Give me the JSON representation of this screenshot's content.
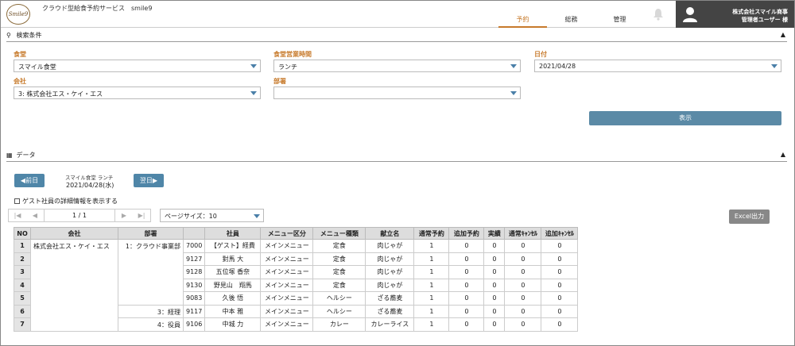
{
  "header": {
    "logo_text": "Smile9",
    "app_title": "クラウド型給食予約サービス　smile9",
    "tabs": [
      {
        "label": "予約",
        "active": true
      },
      {
        "label": "総務",
        "active": false
      },
      {
        "label": "管理",
        "active": false
      }
    ],
    "user_company": "株式会社スマイル商事",
    "user_name": "管理者ユーザー 様"
  },
  "search": {
    "section_title": "検索条件",
    "cafeteria_label": "食堂",
    "cafeteria_value": "スマイル食堂",
    "hours_label": "食堂営業時間",
    "hours_value": "ランチ",
    "date_label": "日付",
    "date_value": "2021/04/28",
    "company_label": "会社",
    "company_value": "3: 株式会社エス・ケイ・エス",
    "dept_label": "部署",
    "dept_value": "",
    "show_button": "表示"
  },
  "data_section": {
    "section_title": "データ",
    "prev_button": "◀前日",
    "next_button": "翌日▶",
    "caf_info": "スマイル食堂 ランチ",
    "caf_date": "2021/04/28(水)",
    "guest_checkbox_label": "ゲスト社員の詳細情報を表示する",
    "pager_info": "1 / 1",
    "page_size": "ページサイズ：10",
    "excel_button": "Excel出力"
  },
  "table": {
    "headers": [
      "NO",
      "会社",
      "部署",
      "社員",
      "",
      "メニュー区分",
      "メニュー種類",
      "献立名",
      "通常予約",
      "追加予約",
      "実績",
      "通常ｷｬﾝｾﾙ",
      "追加ｷｬﾝｾﾙ"
    ],
    "company": "株式会社エス・ケイ・エス",
    "depts": [
      "1：クラウド事業部",
      "3：経理",
      "4：役員"
    ],
    "rows": [
      {
        "no": "1",
        "emp_id": "7000",
        "emp_name": "【ゲスト】経費",
        "menu_cat": "メインメニュー",
        "menu_type": "定食",
        "dish": "肉じゃが",
        "normal": "1",
        "add": "0",
        "actual": "0",
        "ncancel": "0",
        "acancel": "0"
      },
      {
        "no": "2",
        "emp_id": "9127",
        "emp_name": "對馬 大",
        "menu_cat": "メインメニュー",
        "menu_type": "定食",
        "dish": "肉じゃが",
        "normal": "1",
        "add": "0",
        "actual": "0",
        "ncancel": "0",
        "acancel": "0"
      },
      {
        "no": "3",
        "emp_id": "9128",
        "emp_name": "五位塚 香奈",
        "menu_cat": "メインメニュー",
        "menu_type": "定食",
        "dish": "肉じゃが",
        "normal": "1",
        "add": "0",
        "actual": "0",
        "ncancel": "0",
        "acancel": "0"
      },
      {
        "no": "4",
        "emp_id": "9130",
        "emp_name": "野見山　翔馬",
        "menu_cat": "メインメニュー",
        "menu_type": "定食",
        "dish": "肉じゃが",
        "normal": "1",
        "add": "0",
        "actual": "0",
        "ncancel": "0",
        "acancel": "0"
      },
      {
        "no": "5",
        "emp_id": "9083",
        "emp_name": "久後 悟",
        "menu_cat": "メインメニュー",
        "menu_type": "ヘルシー",
        "dish": "ざる蕎麦",
        "normal": "1",
        "add": "0",
        "actual": "0",
        "ncancel": "0",
        "acancel": "0"
      },
      {
        "no": "6",
        "emp_id": "9117",
        "emp_name": "中本 雅",
        "menu_cat": "メインメニュー",
        "menu_type": "ヘルシー",
        "dish": "ざる蕎麦",
        "normal": "1",
        "add": "0",
        "actual": "0",
        "ncancel": "0",
        "acancel": "0"
      },
      {
        "no": "7",
        "emp_id": "9106",
        "emp_name": "中城 力",
        "menu_cat": "メインメニュー",
        "menu_type": "カレー",
        "dish": "カレーライス",
        "normal": "1",
        "add": "0",
        "actual": "0",
        "ncancel": "0",
        "acancel": "0"
      }
    ]
  },
  "colors": {
    "accent": "#c77a2b",
    "button_blue": "#5b8aa6",
    "user_bar": "#444444"
  }
}
